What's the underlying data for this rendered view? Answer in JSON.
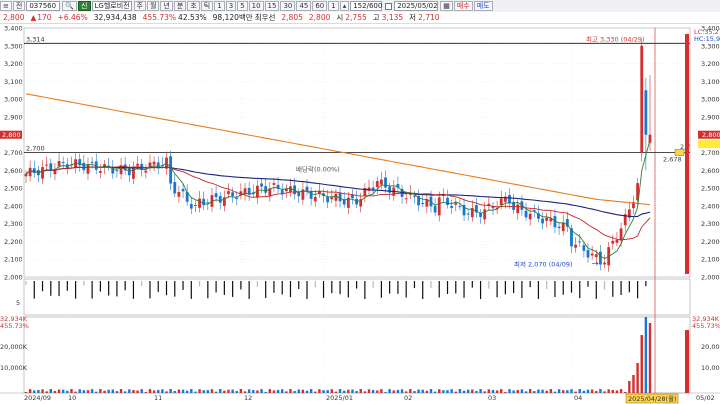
{
  "toolbar": {
    "menu": "≡",
    "market": "전",
    "code": "037560",
    "search_icon": "search-icon",
    "badge_sin": "신",
    "name": "LG헬로비전",
    "periods": [
      "주",
      "월",
      "년",
      "분",
      "초",
      "틱"
    ],
    "intervals": [
      "1",
      "3",
      "5",
      "10",
      "15",
      "30",
      "45",
      "60",
      "1"
    ],
    "count": "152/600",
    "date": "2025/05/02",
    "buy": "매수",
    "sell": "매도"
  },
  "info": {
    "price": "2,800",
    "change": "170",
    "change_pct": "+6.46%",
    "volume": "32,934,438",
    "vol_ratio": "455.73%",
    "turnover_ratio": "42.53%",
    "amount": "98,120백만",
    "ask_label": "최우선",
    "ask": "2,805",
    "bid": "2,800",
    "open_label": "시",
    "open": "2,755",
    "high_label": "고",
    "high": "3,135",
    "low_label": "저",
    "low": "2,710"
  },
  "chart_annotations": {
    "max_price": "최고 3,330 (04/29)",
    "min_price": "최저 2,070 (04/09)",
    "line_3314": "3,314",
    "line_2700": "2,700",
    "dividend": "배당락(0.00%)",
    "right_marker": "2,7",
    "right_marker2": "2,678",
    "lc": "LC:35,27",
    "hc": "HC:15,90",
    "vol_badge": "32,934K",
    "vol_pct": "455.73%",
    "date_badge": "2025/04/28(월)"
  },
  "colors": {
    "up": "#d32f2f",
    "down": "#1976d2",
    "ma5": "#2e7d32",
    "ma20": "#c62828",
    "ma60": "#1a237e",
    "ma120": "#e67e22",
    "vline": "#c62828"
  },
  "chart_data": {
    "type": "candlestick",
    "price_axis": [
      "3,400",
      "3,300",
      "3,200",
      "3,100",
      "3,000",
      "2,900",
      "2,800",
      "2,700",
      "2,600",
      "2,500",
      "2,400",
      "2,300",
      "2,200",
      "2,100",
      "2,000"
    ],
    "ylim": [
      2000,
      3400
    ],
    "vol_axis": [
      "20,000K",
      "10,000K"
    ],
    "lower_axis_label": "5",
    "x_labels": [
      "2024/09",
      "10",
      "11",
      "12",
      "2025/01",
      "02",
      "03",
      "04",
      "05/02"
    ]
  }
}
